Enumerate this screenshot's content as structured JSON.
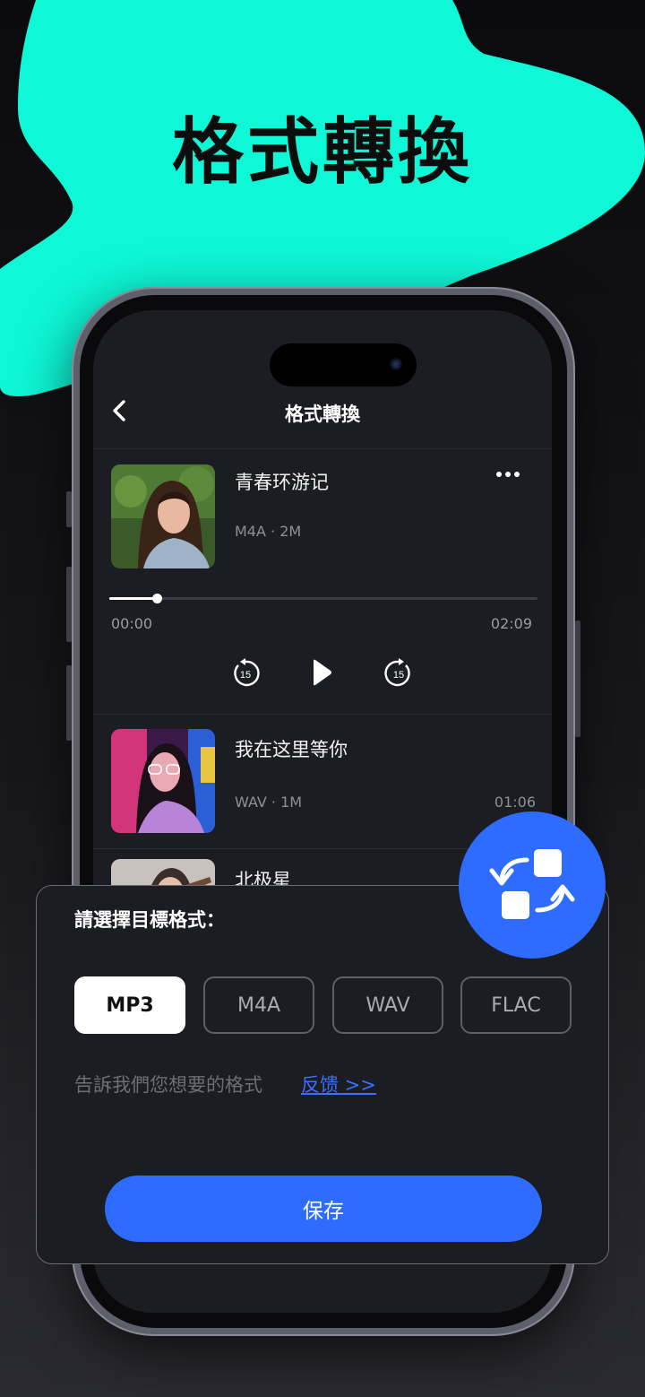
{
  "hero": {
    "title": "格式轉換"
  },
  "colors": {
    "accent": "#0ef7d6",
    "primary": "#2d6cff",
    "background": "#111114",
    "surface": "#1b1d22"
  },
  "nav": {
    "title": "格式轉換",
    "back_icon": "chevron-left-icon"
  },
  "player": {
    "song": {
      "title": "青春环游记",
      "meta": "M4A · 2M"
    },
    "progress": 0.11,
    "current_time": "00:00",
    "total_time": "02:09",
    "controls": [
      "rewind-15-icon",
      "play-icon",
      "forward-15-icon"
    ],
    "skip_seconds": "15"
  },
  "songs": [
    {
      "title": "我在这里等你",
      "meta": "WAV · 1M",
      "duration": "01:06"
    },
    {
      "title": "北极星"
    }
  ],
  "sheet": {
    "title": "請選擇目標格式：",
    "formats": [
      "MP3",
      "M4A",
      "WAV",
      "FLAC"
    ],
    "selected": "MP3",
    "hint": "告訴我們您想要的格式",
    "feedback": "反馈 >>",
    "save": "保存"
  },
  "badge": {
    "icon": "format-convert-icon"
  }
}
